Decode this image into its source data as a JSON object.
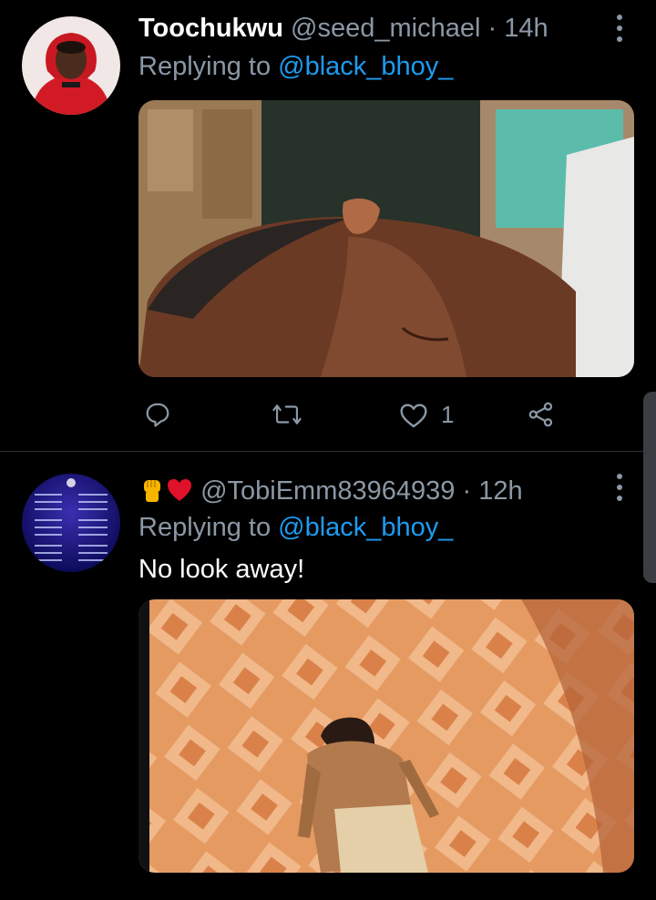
{
  "tweets": [
    {
      "display_name": "Toochukwu",
      "handle": "@seed_michael",
      "separator": "·",
      "time": "14h",
      "replying_prefix": "Replying to",
      "replying_handle": "@black_bhoy_",
      "actions": {
        "reply_count": "",
        "retweet_count": "",
        "like_count": "1"
      },
      "icons": {
        "avatar": "avatar-red-hoodie",
        "media": "photo-sleeping-face"
      }
    },
    {
      "display_name_emoji": "✊❤",
      "handle": "@TobiEmm83964939",
      "separator": "·",
      "time": "12h",
      "replying_prefix": "Replying to",
      "replying_handle": "@black_bhoy_",
      "text": "No look away!",
      "icons": {
        "avatar": "avatar-champions-league-table",
        "media": "photo-man-lying-on-tiles"
      }
    }
  ],
  "colors": {
    "background": "#000000",
    "muted": "#8b98a5",
    "link": "#1d9bf0",
    "divider": "#2f3336"
  }
}
